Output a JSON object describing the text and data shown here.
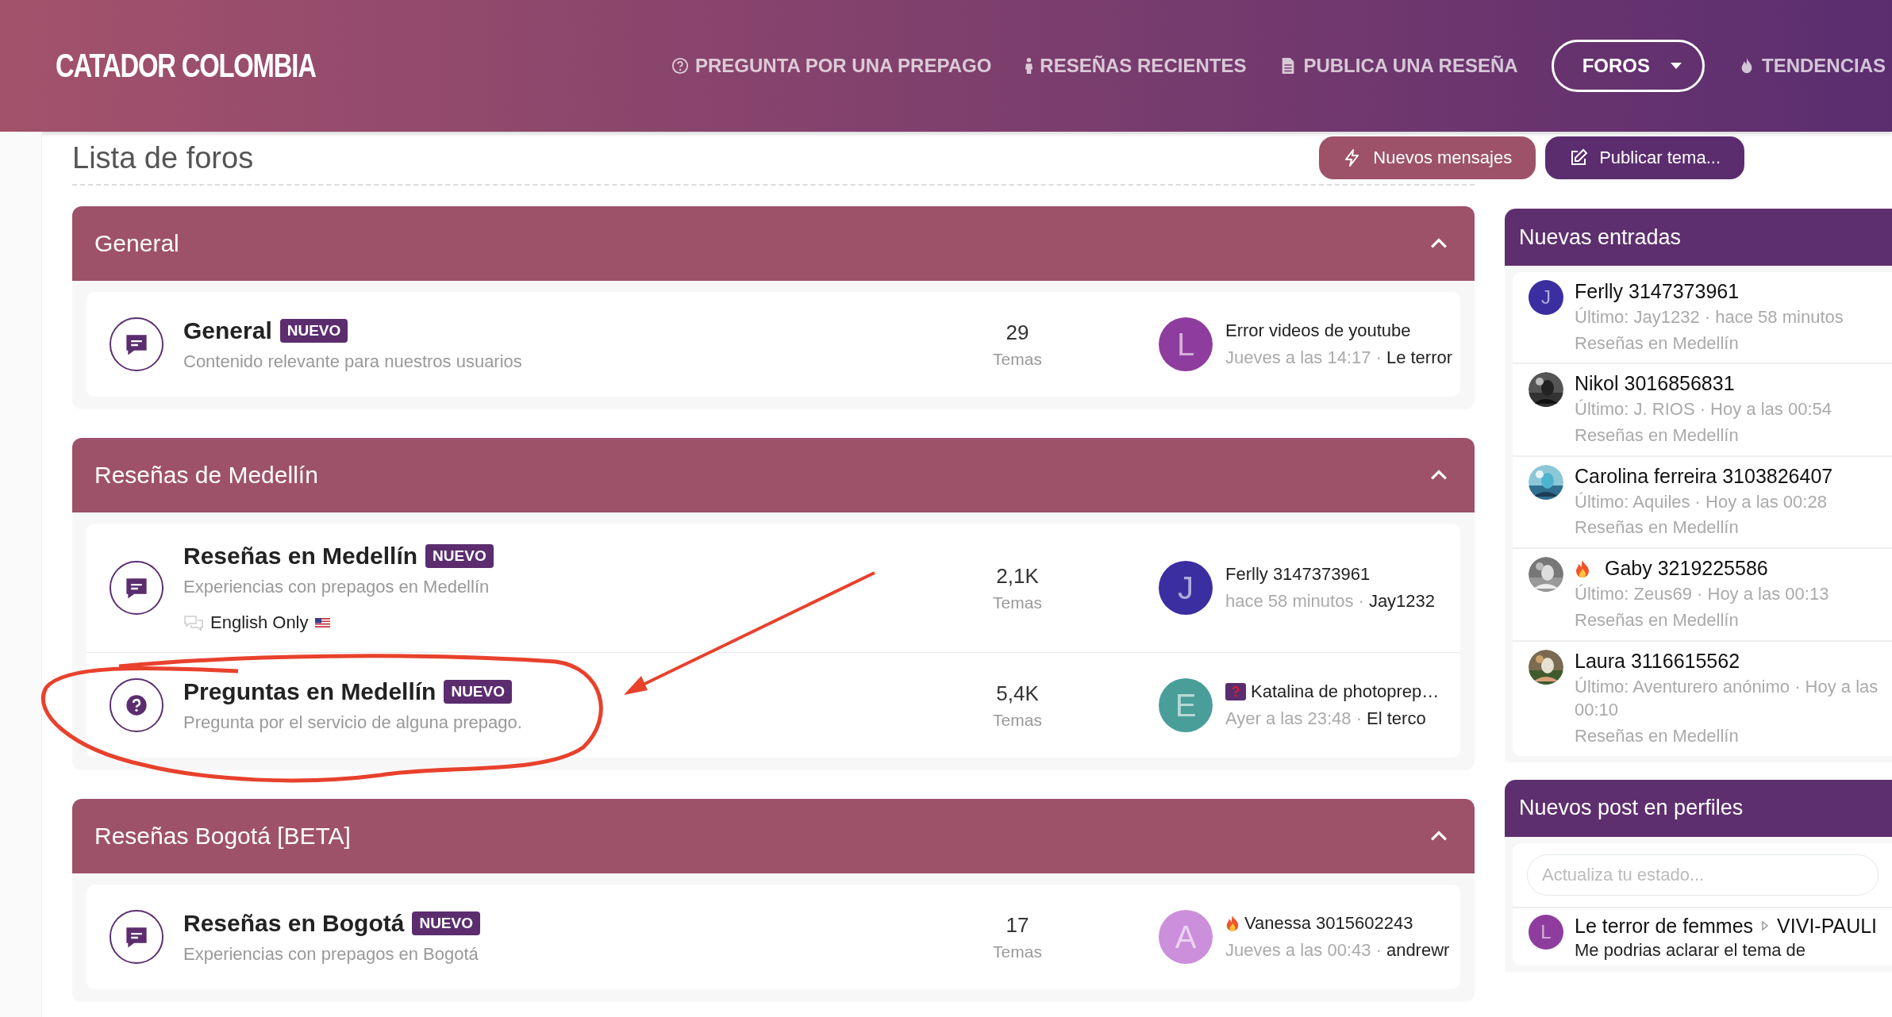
{
  "header": {
    "logo": "CATADOR COLOMBIA",
    "nav": [
      {
        "label": "PREGUNTA POR UNA PREPAGO",
        "kind": "question",
        "selected": false,
        "dropdown": false
      },
      {
        "label": "RESEÑAS RECIENTES",
        "kind": "person",
        "selected": false,
        "dropdown": false
      },
      {
        "label": "PUBLICA UNA RESEÑA",
        "kind": "document",
        "selected": false,
        "dropdown": false
      },
      {
        "label": "FOROS",
        "kind": "plain",
        "selected": true,
        "dropdown": true
      },
      {
        "label": "TENDENCIAS",
        "kind": "fire",
        "selected": false,
        "dropdown": false
      }
    ]
  },
  "page": {
    "title": "Lista de foros",
    "buttons": [
      {
        "label": "Nuevos mensajes",
        "kind": "secondary"
      },
      {
        "label": "Publicar tema...",
        "kind": "primary"
      }
    ]
  },
  "categories": [
    {
      "title": "General",
      "expanded": true,
      "forums": [
        {
          "kind": "chat",
          "title": "General",
          "badge": "NUEVO",
          "description": "Contenido relevante para nuestros usuarios",
          "count": "29",
          "count_label": "Temas",
          "last": {
            "kind": "plain",
            "avatar": {
              "kind": "letter",
              "letter": "L",
              "color": "#8e3d9e"
            },
            "title": "Error videos de youtube",
            "time": "Jueves a las 14:17 ·",
            "user": "Le terror"
          }
        }
      ]
    },
    {
      "title": "Reseñas de Medellín",
      "expanded": true,
      "forums": [
        {
          "kind": "chat",
          "title": "Reseñas en Medellín",
          "badge": "NUEVO",
          "description": "Experiencias con prepagos en Medellín",
          "extra": {
            "label": "English Only"
          },
          "count": "2,1K",
          "count_label": "Temas",
          "last": {
            "kind": "plain",
            "avatar": {
              "kind": "letter",
              "letter": "J",
              "color": "#3a2ea0"
            },
            "title": "Ferlly 3147373961",
            "time": "hace 58 minutos ·",
            "user": "Jay1232"
          }
        },
        {
          "kind": "question",
          "title": "Preguntas en Medellín",
          "badge": "NUEVO",
          "description": "Pregunta por el servicio de alguna prepago.",
          "count": "5,4K",
          "count_label": "Temas",
          "last": {
            "kind": "question",
            "avatar": {
              "kind": "letter",
              "letter": "E",
              "color": "#4a9e9a"
            },
            "title": "Katalina de photoprep…",
            "time": "Ayer a las 23:48 ·",
            "user": "El terco"
          }
        }
      ]
    },
    {
      "title": "Reseñas Bogotá [BETA]",
      "expanded": true,
      "forums": [
        {
          "kind": "chat",
          "title": "Reseñas en Bogotá",
          "badge": "NUEVO",
          "description": "Experiencias con prepagos en Bogotá",
          "count": "17",
          "count_label": "Temas",
          "last": {
            "kind": "fire",
            "avatar": {
              "kind": "letter",
              "letter": "A",
              "color": "#cc8fdc"
            },
            "title": "Vanessa 3015602243",
            "time": "Jueves a las 00:43 ·",
            "user": "andrewr"
          }
        }
      ]
    }
  ],
  "sidebar": {
    "new_entries": {
      "title": "Nuevas entradas",
      "items": [
        {
          "kind": "plain",
          "avatar": {
            "kind": "letter",
            "letter": "J",
            "color": "#3a2ea0"
          },
          "title": "Ferlly 3147373961",
          "meta": "Último: Jay1232 · hace 58 minutos",
          "forum": "Reseñas en Medellín"
        },
        {
          "kind": "plain",
          "title": "Nikol 3016856831",
          "meta": "Último: J. RIOS · Hoy a las 00:54",
          "forum": "Reseñas en Medellín"
        },
        {
          "kind": "plain",
          "title": "Carolina ferreira 3103826407",
          "meta": "Último: Aquiles · Hoy a las 00:28",
          "forum": "Reseñas en Medellín"
        },
        {
          "kind": "fire",
          "title": "Gaby 3219225586",
          "meta": "Último: Zeus69 · Hoy a las 00:13",
          "forum": "Reseñas en Medellín"
        },
        {
          "kind": "plain",
          "title": "Laura 3116615562",
          "meta": "Último: Aventurero anónimo · Hoy a las 00:10",
          "forum": "Reseñas en Medellín"
        }
      ]
    },
    "profile_posts": {
      "title": "Nuevos post en perfiles",
      "placeholder": "Actualiza tu estado...",
      "posts": [
        {
          "avatar": {
            "kind": "letter",
            "letter": "L",
            "color": "#8e3d9e"
          },
          "author": "Le terror de femmes",
          "target": "VIVI-PAULI",
          "text": "Me podrias aclarar el tema de"
        }
      ]
    }
  }
}
